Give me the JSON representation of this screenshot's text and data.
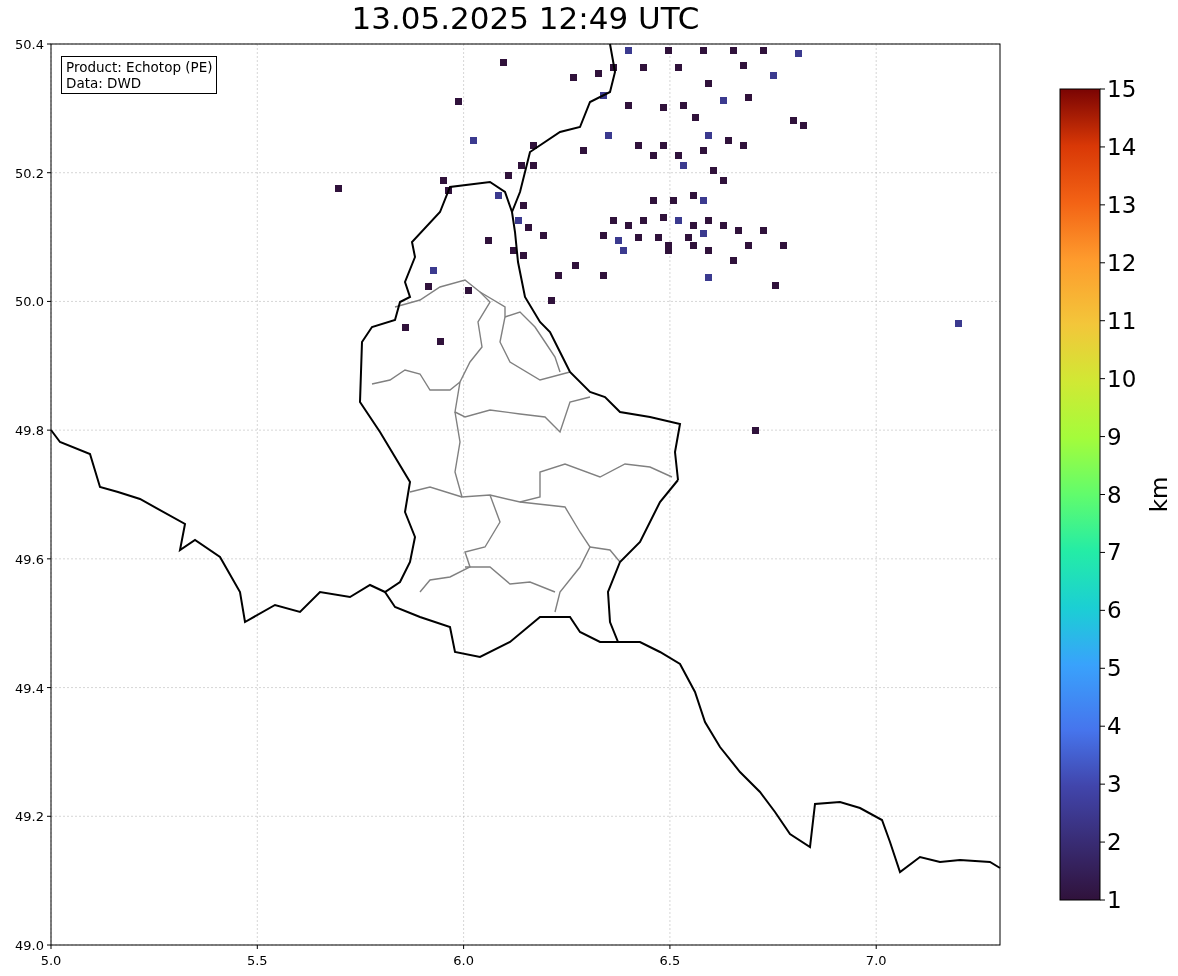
{
  "title": "13.05.2025 12:49 UTC",
  "info_box": {
    "lines": [
      "Product: Echotop (PE)",
      "Data: DWD"
    ]
  },
  "x_ticks": [
    "5.0",
    "5.5",
    "6.0",
    "6.5",
    "7.0"
  ],
  "y_ticks": [
    "50.4",
    "50.2",
    "50.0",
    "49.8",
    "49.6",
    "49.4",
    "49.2",
    "49.0"
  ],
  "colorbar": {
    "ticks": [
      "15",
      "14",
      "13",
      "12",
      "11",
      "10",
      "9",
      "8",
      "7",
      "6",
      "5",
      "4",
      "3",
      "2",
      "1"
    ],
    "label": "km"
  }
}
